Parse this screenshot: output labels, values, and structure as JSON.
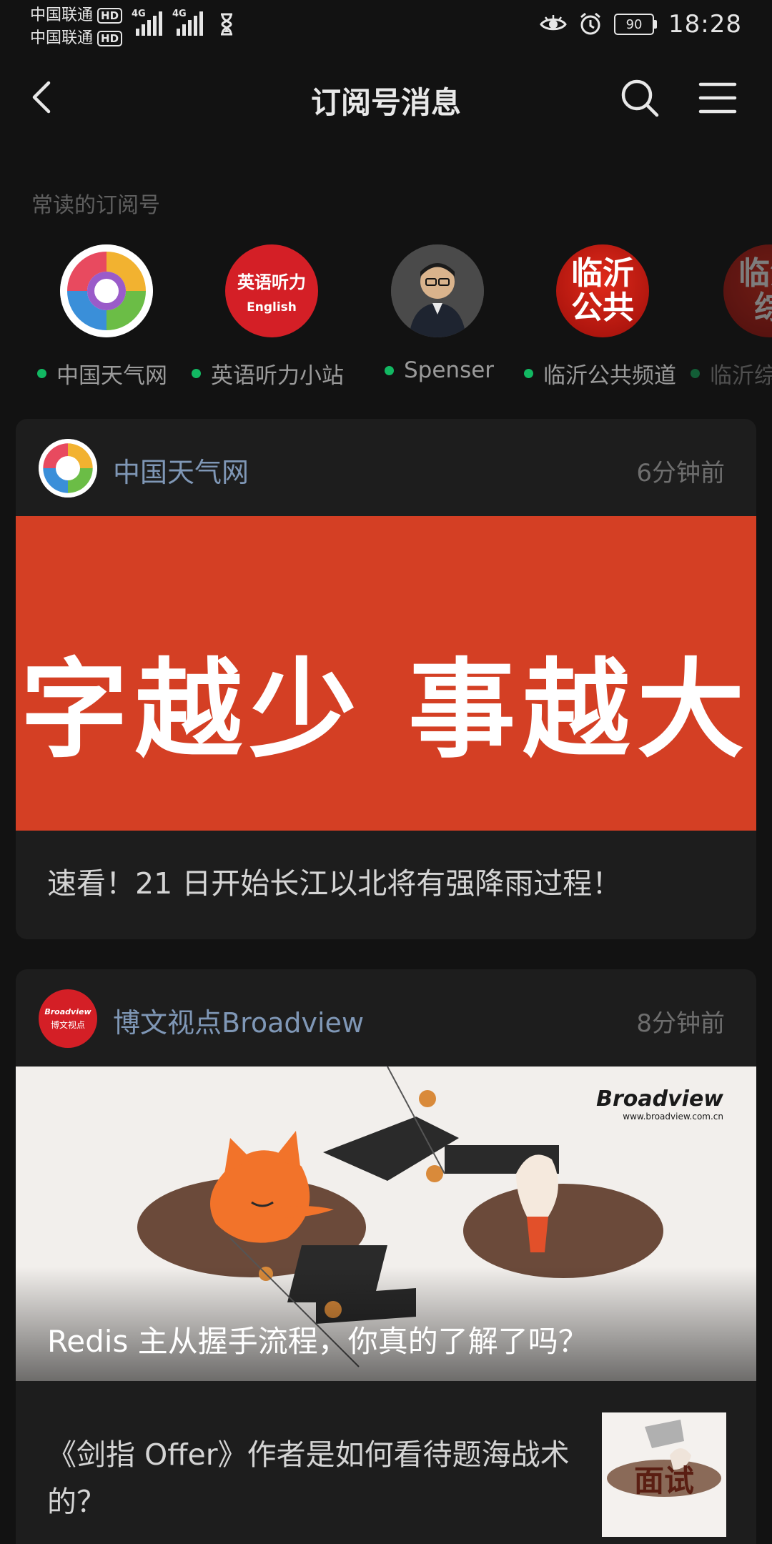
{
  "status_bar": {
    "carrier_1": "中国联通",
    "carrier_2": "中国联通",
    "hd_badge": "HD",
    "network_type": "4G",
    "battery_level": "90",
    "time": "18:28"
  },
  "header": {
    "title": "订阅号消息"
  },
  "frequent": {
    "label": "常读的订阅号",
    "items": [
      {
        "name": "中国天气网"
      },
      {
        "name": "英语听力小站",
        "avatar_line1": "英语听力",
        "avatar_line2": "English"
      },
      {
        "name": "Spenser"
      },
      {
        "name": "临沂公共频道",
        "avatar_line1": "临沂",
        "avatar_line2": "公共"
      },
      {
        "name": "临沂综",
        "avatar_line1": "临沂",
        "avatar_line2": "综"
      }
    ]
  },
  "feed": [
    {
      "account": "中国天气网",
      "time": "6分钟前",
      "banner_text": "字越少  事越大",
      "title": "速看！21 日开始长江以北将有强降雨过程！"
    },
    {
      "account": "博文视点Broadview",
      "time": "8分钟前",
      "avatar_line1": "Broadview",
      "avatar_line2": "博文视点",
      "banner_brand": "Broadview",
      "banner_url": "www.broadview.com.cn",
      "banner_title": "Redis 主从握手流程，你真的了解了吗？",
      "sub_article": {
        "title": "《剑指 Offer》作者是如何看待题海战术的？",
        "thumb_text": "面试"
      }
    }
  ],
  "colors": {
    "background": "#121212",
    "card": "#1d1d1d",
    "account_link": "#7f97b6",
    "online_dot": "#12b862",
    "banner_red": "#d43f24"
  }
}
